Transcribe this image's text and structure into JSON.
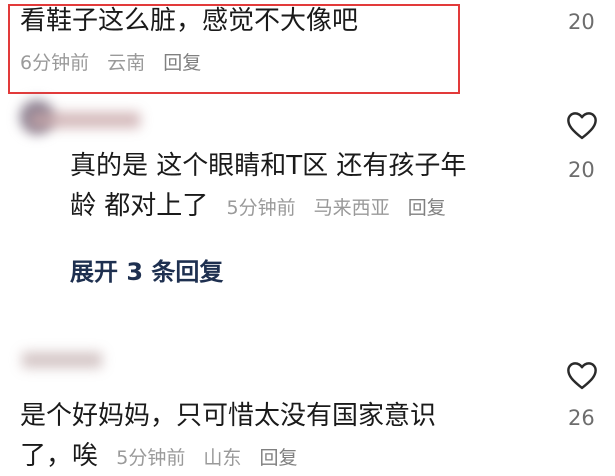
{
  "comments": [
    {
      "text_lines": [
        "看鞋子这么脏，感觉不大像吧"
      ],
      "time": "6分钟前",
      "location": "云南",
      "reply": "回复",
      "likes": "20"
    },
    {
      "text_lines": [
        "真的是 这个眼睛和T区 还有孩子年",
        "龄 都对上了"
      ],
      "time": "5分钟前",
      "location": "马来西亚",
      "reply": "回复",
      "likes": "20"
    },
    {
      "text_lines": [
        "是个好妈妈，只可惜太没有国家意识",
        "了，唉"
      ],
      "time": "5分钟前",
      "location": "山东",
      "reply": "回复",
      "likes": "26"
    }
  ],
  "expand_replies": "展开 3 条回复",
  "icons": {
    "like": "heart-outline-icon"
  },
  "colors": {
    "highlight": "#e23a3a",
    "expand": "#1e3050",
    "meta": "#9a9a9a"
  }
}
